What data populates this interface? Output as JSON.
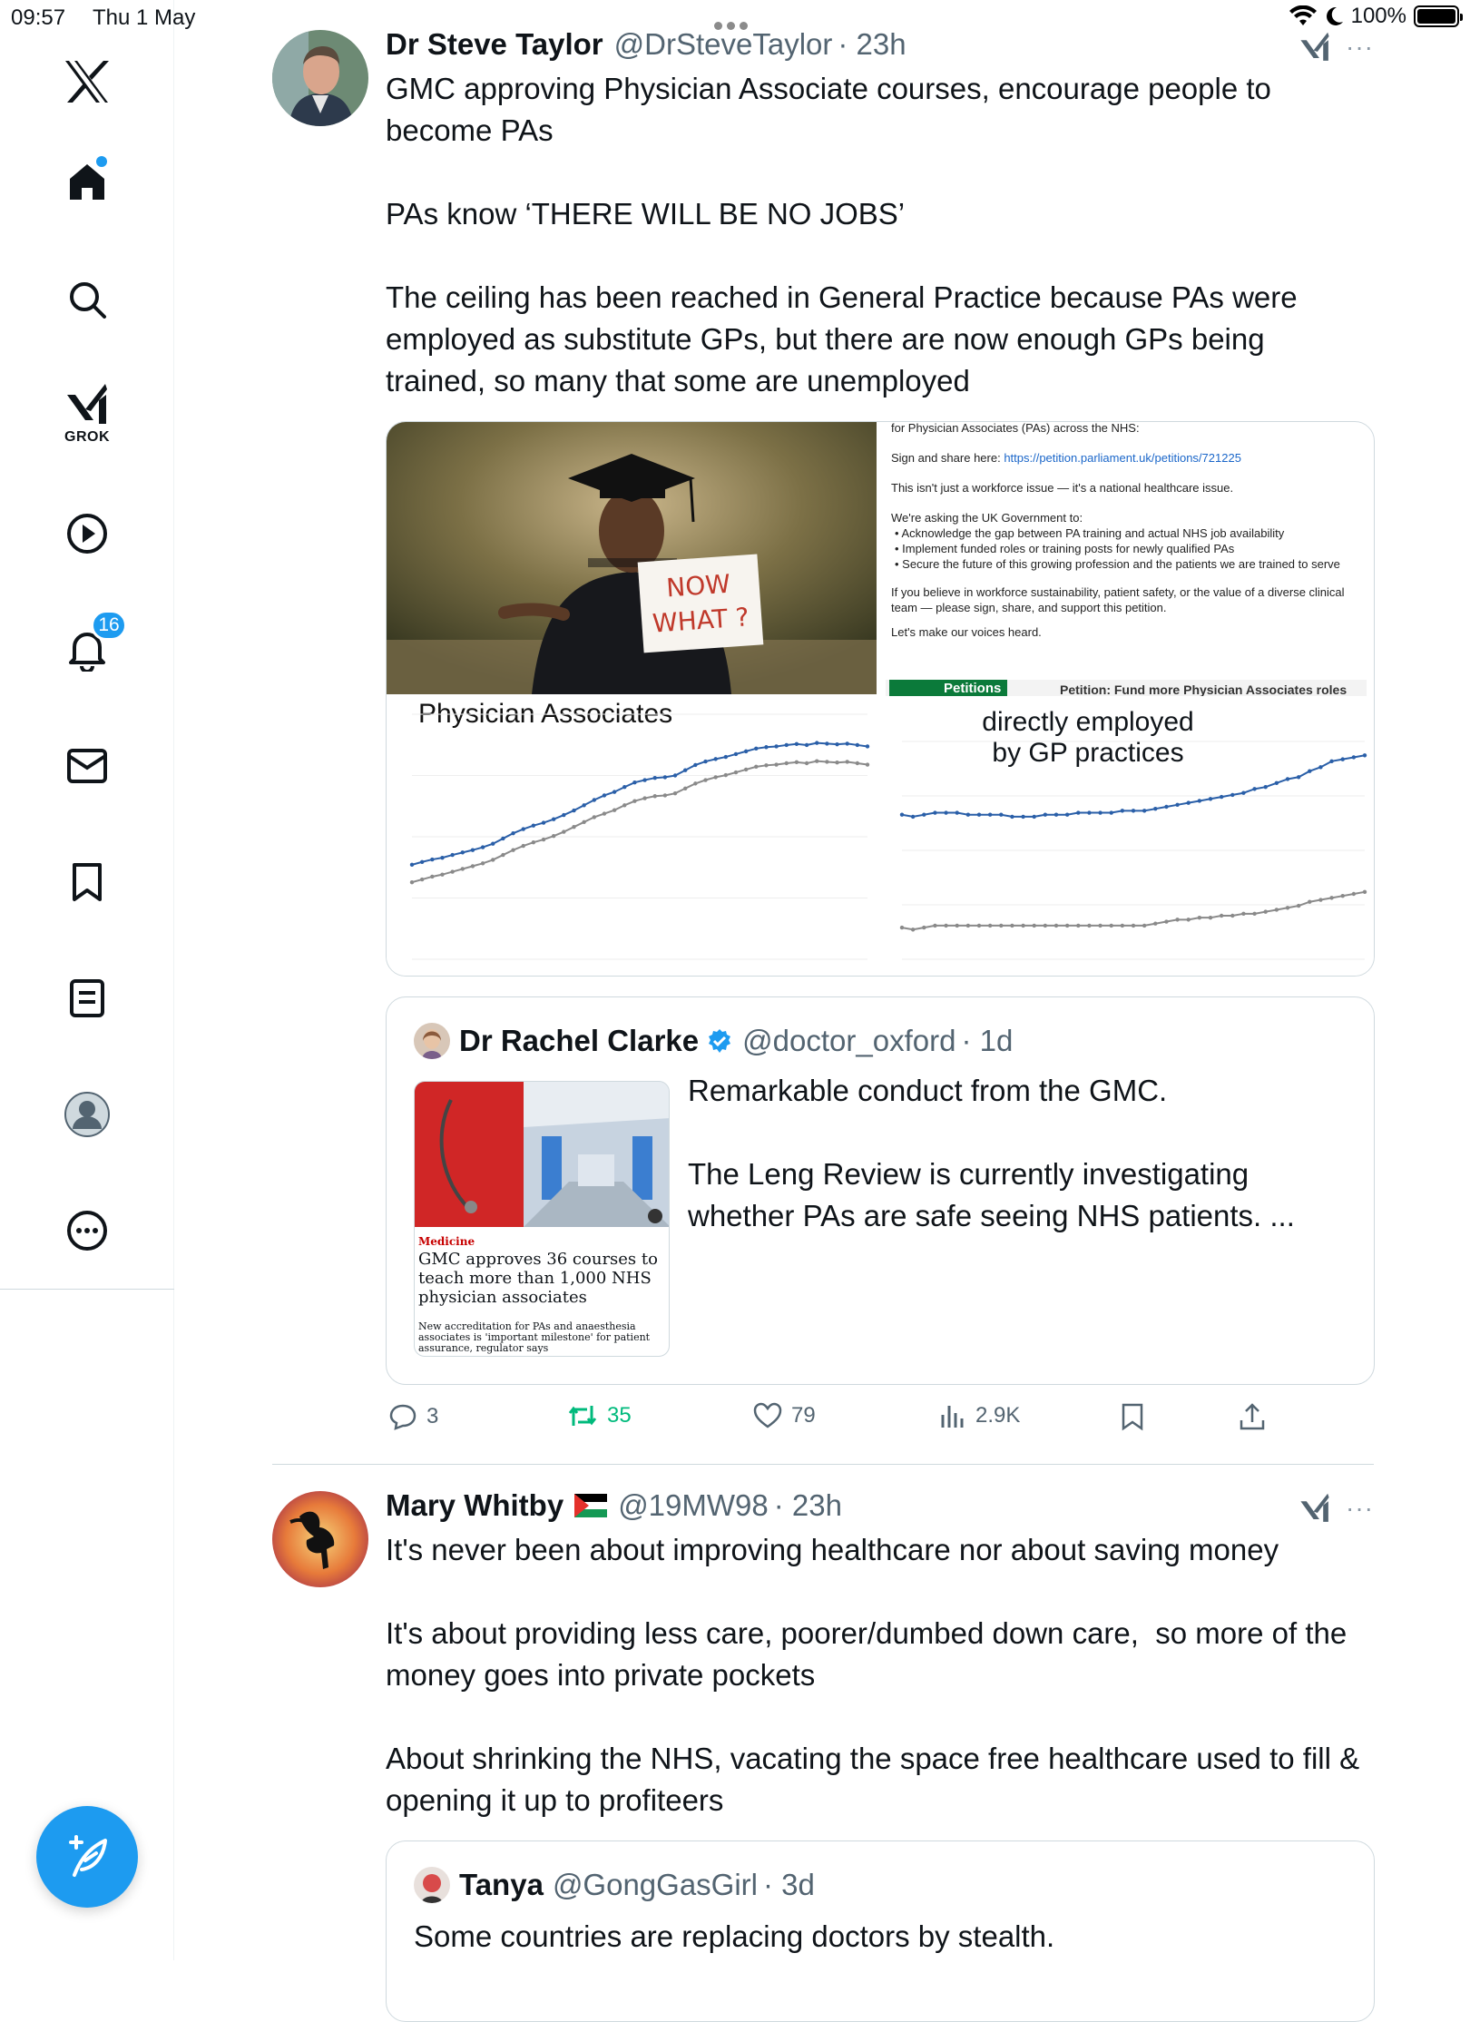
{
  "status_bar": {
    "time": "09:57",
    "date": "Thu 1 May",
    "battery": "100%"
  },
  "sidebar": {
    "grok_label": "GROK",
    "notifications_count": "16"
  },
  "posts": [
    {
      "author": "Dr Steve Taylor",
      "handle": "@DrSteveTaylor",
      "time": "· 23h",
      "text": "GMC approving Physician Associate courses, encourage people to become PAs\n\nPAs know ‘THERE WILL BE NO JOBS’\n\nThe ceiling has been reached in General Practice because PAs were employed as substitute GPs, but there are now enough GPs being trained, so many that some are unemployed",
      "media": {
        "sign_text_1": "NOW",
        "sign_text_2": "WHAT ?",
        "petition": {
          "line1": "for Physician Associates (PAs) across the NHS:",
          "sign_prefix": "Sign and share here: ",
          "sign_link": "https://petition.parliament.uk/petitions/721225",
          "line3": "This isn't just a workforce issue — it's a national healthcare issue.",
          "line4": "We're asking the UK Government to:",
          "bullet1": "• Acknowledge the gap between PA training and actual NHS job availability",
          "bullet2": "• Implement funded roles or training posts for newly qualified PAs",
          "bullet3": "• Secure the future of this growing profession and the patients we are trained to serve",
          "line5": "If you believe in workforce sustainability, patient safety, or the value of a diverse clinical team — please sign, share, and support this petition.",
          "line6": "Let's make our voices heard.",
          "banner_left": "Petitions",
          "banner_right": "Petition: Fund more Physician Associates roles"
        }
      },
      "chart_left_label": "Physician Associates",
      "chart_right_label_1": "directly employed",
      "chart_right_label_2": "by GP practices",
      "quote": {
        "author": "Dr Rachel Clarke",
        "handle": "@doctor_oxford",
        "time": "· 1d",
        "text": "Remarkable conduct from the GMC.\n\nThe Leng Review is currently investigating whether PAs are safe seeing NHS patients. ...",
        "article_section": "Medicine",
        "article_headline": "GMC approves 36 courses to teach more than 1,000 NHS physician associates",
        "article_standfirst": "New accreditation for PAs and anaesthesia associates is 'important milestone' for patient assurance, regulator says"
      },
      "actions": {
        "replies": "3",
        "reposts": "35",
        "likes": "79",
        "views": "2.9K"
      }
    },
    {
      "author": "Mary Whitby",
      "handle": "@19MW98",
      "time": "· 23h",
      "text": "It's never been about improving healthcare nor about saving money\n\nIt's about providing less care, poorer/dumbed down care,  so more of the money goes into private pockets\n\nAbout shrinking the NHS, vacating the space free healthcare used to fill & opening it up to profiteers",
      "quote": {
        "author": "Tanya",
        "handle": "@GongGasGirl",
        "time": "· 3d",
        "text": "Some countries are replacing doctors by stealth."
      }
    }
  ],
  "chart_data": [
    {
      "type": "line",
      "title": "Physician Associates",
      "series": [
        {
          "values": [
            470,
            478,
            485,
            490,
            498,
            505,
            512,
            520,
            530,
            545,
            560,
            572,
            582,
            590,
            600,
            612,
            625,
            640,
            655,
            668,
            678,
            692,
            705,
            712,
            718,
            720,
            725,
            740,
            755,
            765,
            772,
            778,
            786,
            794,
            802,
            806,
            808,
            812,
            815,
            812,
            818,
            816,
            814,
            816,
            812,
            808
          ]
        },
        {
          "values": [
            420,
            428,
            436,
            442,
            450,
            458,
            466,
            474,
            484,
            498,
            512,
            524,
            534,
            542,
            552,
            564,
            578,
            592,
            606,
            616,
            626,
            640,
            652,
            660,
            666,
            668,
            674,
            688,
            702,
            712,
            720,
            726,
            734,
            742,
            750,
            754,
            756,
            760,
            763,
            760,
            766,
            764,
            762,
            764,
            760,
            756
          ]
        }
      ]
    },
    {
      "type": "line",
      "title": "directly employed by GP practices",
      "series": [
        {
          "values": [
            158,
            157,
            158,
            159,
            159,
            159,
            158,
            158,
            158,
            158,
            157,
            157,
            157,
            158,
            158,
            158,
            159,
            159,
            159,
            159,
            160,
            160,
            160,
            161,
            162,
            163,
            164,
            165,
            166,
            167,
            168,
            169,
            171,
            172,
            174,
            176,
            177,
            180,
            182,
            185,
            186,
            187,
            188
          ]
        },
        {
          "values": [
            101,
            100,
            101,
            102,
            102,
            102,
            102,
            102,
            102,
            102,
            102,
            102,
            102,
            102,
            102,
            102,
            102,
            102,
            102,
            102,
            102,
            102,
            102,
            103,
            104,
            105,
            105,
            106,
            106,
            107,
            107,
            108,
            108,
            109,
            110,
            111,
            112,
            114,
            115,
            116,
            117,
            118,
            119
          ]
        }
      ]
    }
  ]
}
